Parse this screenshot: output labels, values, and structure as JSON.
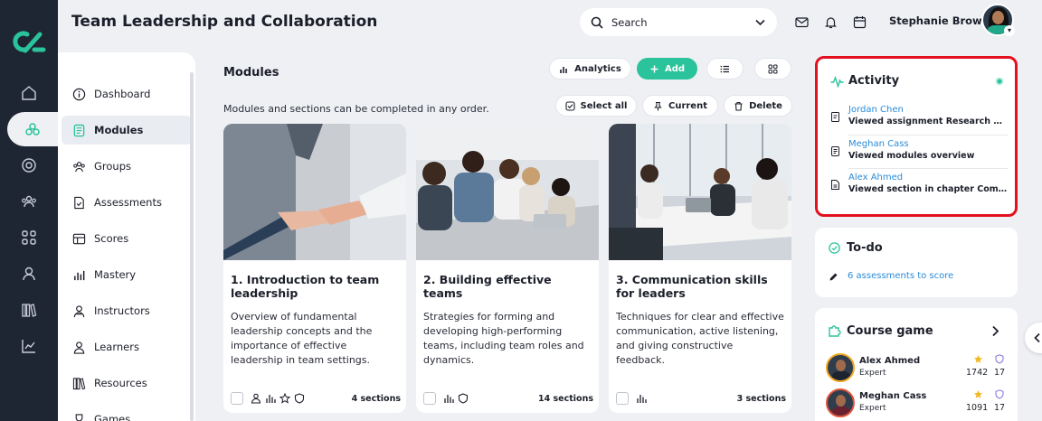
{
  "header": {
    "title": "Team Leadership and Collaboration",
    "search_placeholder": "Search",
    "user_name": "Stephanie Brown"
  },
  "sidenav": {
    "items": [
      {
        "label": "Dashboard",
        "icon": "info-circle-icon"
      },
      {
        "label": "Modules",
        "icon": "book-icon",
        "active": true
      },
      {
        "label": "Groups",
        "icon": "groups-icon"
      },
      {
        "label": "Assessments",
        "icon": "file-check-icon"
      },
      {
        "label": "Scores",
        "icon": "table-icon"
      },
      {
        "label": "Mastery",
        "icon": "bar-chart-icon"
      },
      {
        "label": "Instructors",
        "icon": "instructor-icon"
      },
      {
        "label": "Learners",
        "icon": "learner-icon"
      },
      {
        "label": "Resources",
        "icon": "library-icon"
      },
      {
        "label": "Games",
        "icon": "trophy-icon"
      }
    ]
  },
  "main": {
    "title": "Modules",
    "subtitle": "Modules and sections can be completed in any order.",
    "actions": {
      "analytics": "Analytics",
      "add": "Add",
      "select_all": "Select all",
      "current": "Current",
      "delete": "Delete"
    },
    "cards": [
      {
        "title": "1. Introduction to team leadership",
        "description": "Overview of fundamental leadership concepts and the importance of effective leadership in team settings.",
        "sections": "4 sections"
      },
      {
        "title": "2. Building effective teams",
        "description": "Strategies for forming and developing high-performing teams, including team roles and dynamics.",
        "sections": "14 sections"
      },
      {
        "title": "3. Communication skills for leaders",
        "description": "Techniques for clear and effective communication, active listening, and giving constructive feedback.",
        "sections": "3 sections"
      }
    ]
  },
  "activity": {
    "title": "Activity",
    "items": [
      {
        "name": "Jordan Chen",
        "action": "Viewed assignment Research methods"
      },
      {
        "name": "Meghan Cass",
        "action": "Viewed modules overview"
      },
      {
        "name": "Alex Ahmed",
        "action": "Viewed section in chapter Communication"
      }
    ]
  },
  "todo": {
    "title": "To-do",
    "link": "6 assessments to score"
  },
  "game": {
    "title": "Course game",
    "players": [
      {
        "name": "Alex Ahmed",
        "level_label": "Expert",
        "points": "1742",
        "level": "17"
      },
      {
        "name": "Meghan Cass",
        "level_label": "Expert",
        "points": "1091",
        "level": "17"
      }
    ]
  },
  "colors": {
    "accent": "#2bc39b",
    "rail": "#1e2633",
    "link": "#2a8bd8",
    "highlight": "#e3101f"
  }
}
